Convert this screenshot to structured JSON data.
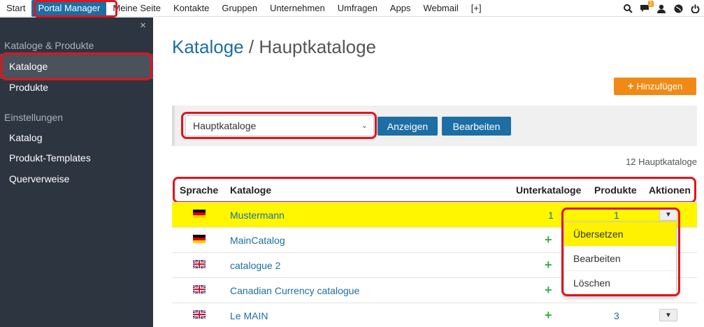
{
  "topnav": {
    "items": [
      "Start",
      "Portal Manager",
      "Meine Seite",
      "Kontakte",
      "Gruppen",
      "Unternehmen",
      "Umfragen",
      "Apps",
      "Webmail",
      "[+]"
    ],
    "active": "Portal Manager",
    "notification_count": "2"
  },
  "sidebar": {
    "close_label": "×",
    "section1": "Kataloge & Produkte",
    "item_kataloge": "Kataloge",
    "item_produkte": "Produkte",
    "section2": "Einstellungen",
    "item_katalog": "Katalog",
    "item_templates": "Produkt-Templates",
    "item_querverweise": "Querverweise"
  },
  "main": {
    "title_crumb": "Kataloge",
    "title_sep": " / ",
    "title_page": "Hauptkataloge",
    "add_button": "Hinzufügen",
    "select_value": "Hauptkataloge",
    "show_button": "Anzeigen",
    "edit_button": "Bearbeiten",
    "count_text": "12 Hauptkataloge"
  },
  "table": {
    "headers": {
      "sprache": "Sprache",
      "kataloge": "Kataloge",
      "unterkataloge": "Unterkataloge",
      "produkte": "Produkte",
      "aktionen": "Aktionen"
    },
    "rows": [
      {
        "lang": "de",
        "name": "Mustermann",
        "sub": "1",
        "prod": "1"
      },
      {
        "lang": "de",
        "name": "MainCatalog",
        "sub": "",
        "prod": ""
      },
      {
        "lang": "uk",
        "name": "catalogue 2",
        "sub": "",
        "prod": ""
      },
      {
        "lang": "uk",
        "name": "Canadian Currency catalogue",
        "sub": "",
        "prod": ""
      },
      {
        "lang": "uk",
        "name": "Le MAIN",
        "sub": "",
        "prod": "3"
      }
    ]
  },
  "menu": {
    "translate": "Übersetzen",
    "edit": "Bearbeiten",
    "delete": "Löschen"
  },
  "colors": {
    "brand_blue": "#1c6ea4",
    "sidebar_bg": "#2d3540",
    "add_orange": "#f08a14",
    "highlight_yellow": "#fff600",
    "annotation_red": "#e0141e"
  }
}
